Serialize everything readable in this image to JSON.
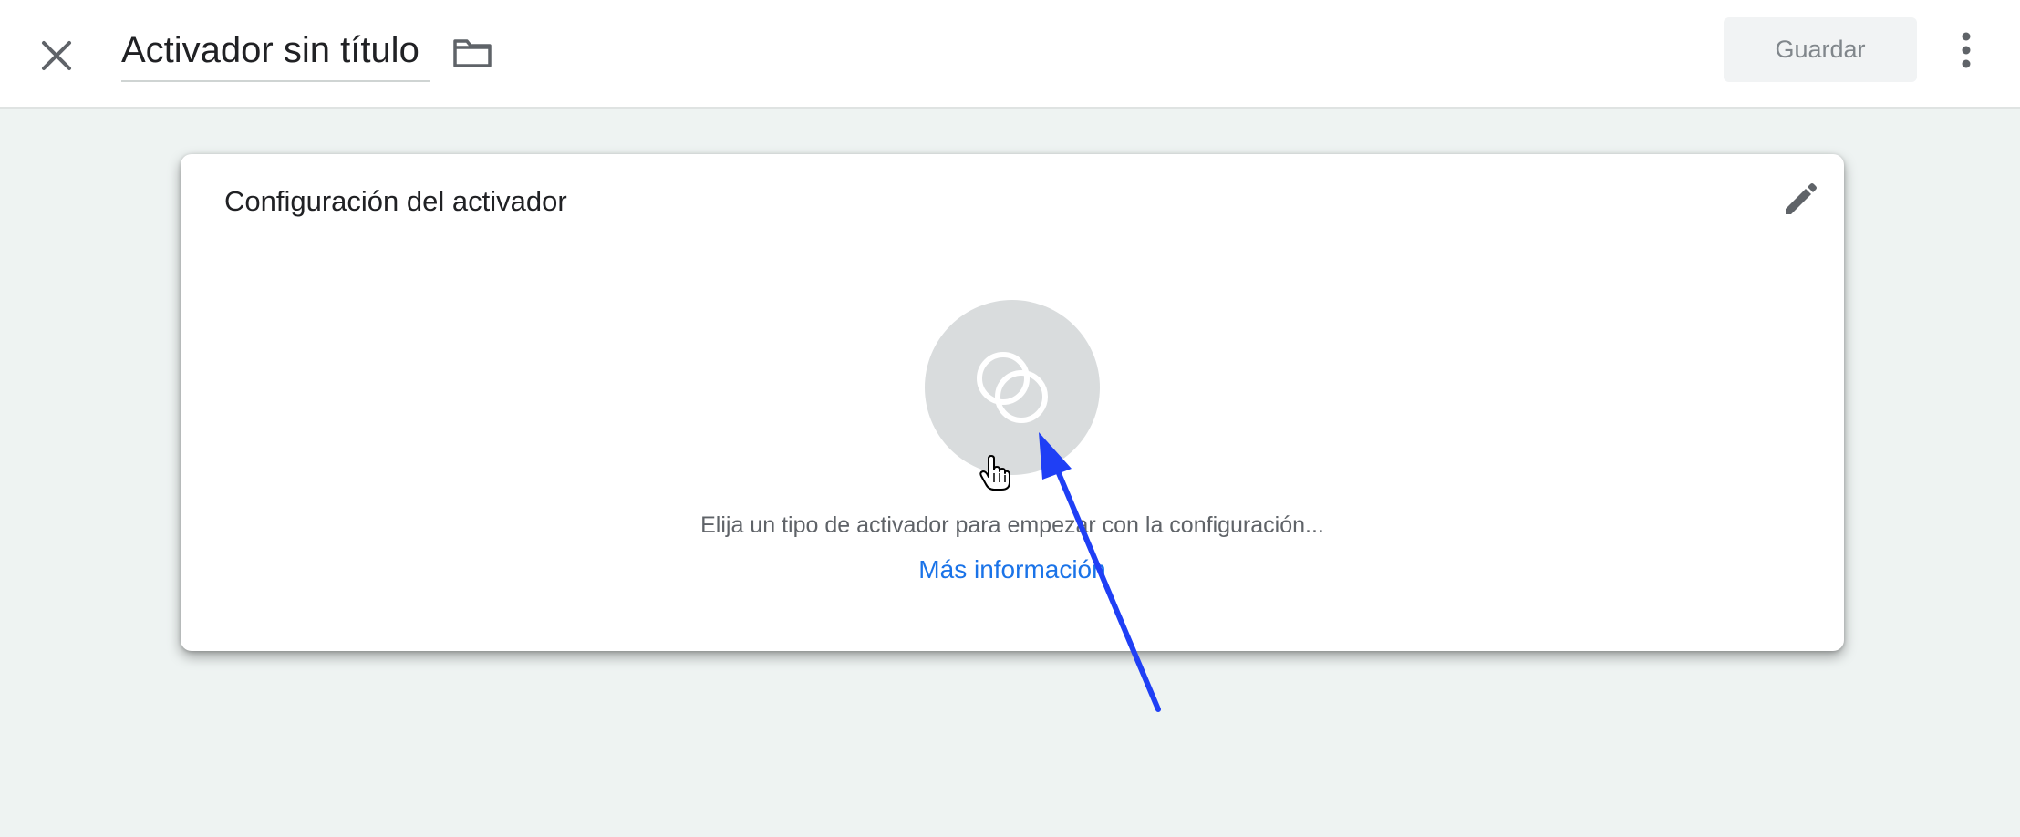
{
  "header": {
    "title": "Activador sin título",
    "save_label": "Guardar",
    "close_icon": "close-icon",
    "folder_icon": "folder-icon",
    "more_icon": "more-vert-icon"
  },
  "card": {
    "title": "Configuración del activador",
    "edit_icon": "pencil-icon",
    "type_icon": "trigger-type-icon",
    "hint": "Elija un tipo de activador para empezar con la configuración...",
    "learn_more": "Más información"
  },
  "colors": {
    "background": "#eef3f2",
    "save_bg": "#f1f3f4",
    "save_text": "#80868b",
    "link": "#1a73e8",
    "circle": "#d9dcdd",
    "arrow": "#1f3ff5"
  }
}
